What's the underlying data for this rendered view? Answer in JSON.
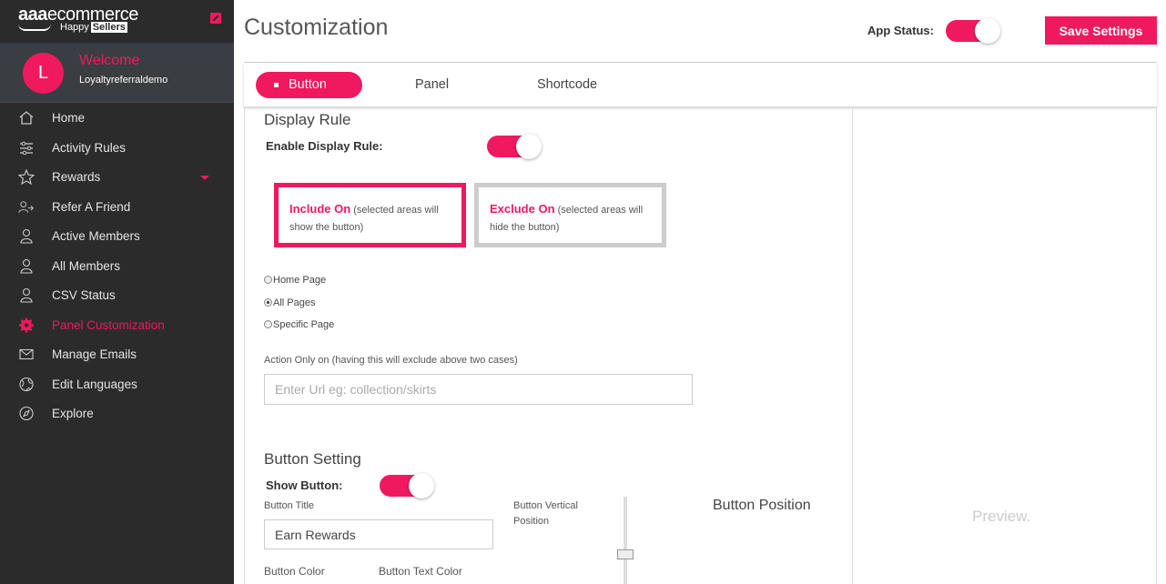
{
  "brand": {
    "logo_bold": "aaa",
    "logo_rest": "ecommerce",
    "sub_prefix": "Happy",
    "sub_badge": "Sellers"
  },
  "user": {
    "initial": "L",
    "welcome": "Welcome",
    "name": "Loyaltyreferraldemo"
  },
  "nav": [
    {
      "label": "Home",
      "icon": "home-icon"
    },
    {
      "label": "Activity Rules",
      "icon": "sliders-icon"
    },
    {
      "label": "Rewards",
      "icon": "star-icon"
    },
    {
      "label": "Refer A Friend",
      "icon": "user-share-icon"
    },
    {
      "label": "Active Members",
      "icon": "user-icon"
    },
    {
      "label": "All Members",
      "icon": "user-icon"
    },
    {
      "label": "CSV Status",
      "icon": "user-icon"
    },
    {
      "label": "Panel Customization",
      "icon": "gear-icon",
      "active": true
    },
    {
      "label": "Manage Emails",
      "icon": "mail-icon"
    },
    {
      "label": "Edit Languages",
      "icon": "globe-icon"
    },
    {
      "label": "Explore",
      "icon": "compass-icon"
    }
  ],
  "header": {
    "title": "Customization",
    "app_status_label": "App Status:",
    "app_status_on": true,
    "save_label": "Save Settings"
  },
  "tabs": [
    "Button",
    "Panel",
    "Shortcode"
  ],
  "display_rule": {
    "heading": "Display Rule",
    "enable_label": "Enable Display Rule:",
    "enabled": true,
    "include_title": "Include On",
    "include_desc": "(selected areas will show the button)",
    "exclude_title": "Exclude On",
    "exclude_desc": "(selected areas will hide the button)",
    "options": [
      "Home Page",
      "All Pages",
      "Specific Page"
    ],
    "selected_option": "All Pages",
    "action_label": "Action Only on (having this will exclude above two cases)",
    "url_placeholder": "Enter Url eg: collection/skirts"
  },
  "button_setting": {
    "heading": "Button Setting",
    "show_label": "Show Button:",
    "show_on": true,
    "title_label": "Button Title",
    "title_value": "Earn Rewards",
    "vertical_label": "Button Vertical Position",
    "position_label": "Button Position",
    "color_label": "Button Color",
    "text_color_label": "Button Text Color"
  },
  "preview_label": "Preview.",
  "colors": {
    "accent": "#f0195f",
    "sidebar": "#2b2b2b",
    "user_panel": "#3a3d42"
  }
}
